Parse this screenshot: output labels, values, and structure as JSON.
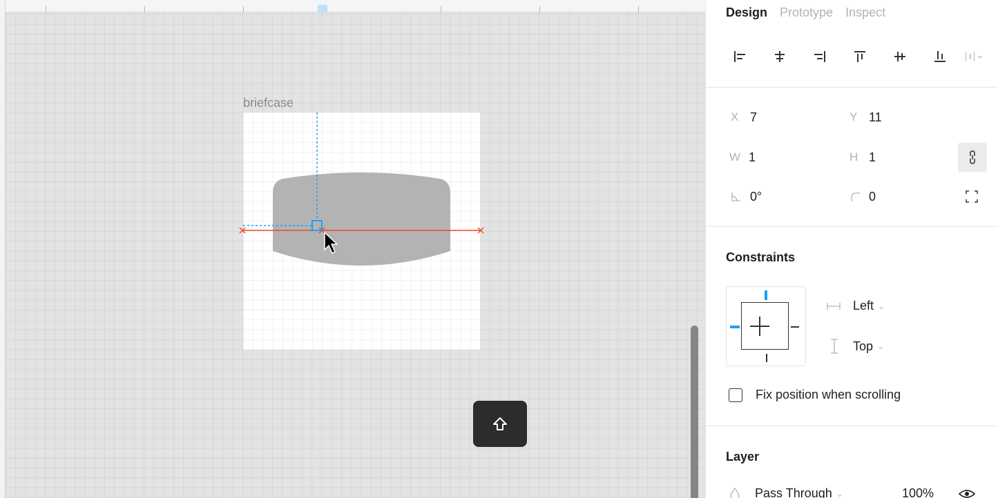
{
  "canvas": {
    "frame_label": "briefcase"
  },
  "tabs": [
    {
      "label": "Design",
      "active": true
    },
    {
      "label": "Prototype",
      "active": false
    },
    {
      "label": "Inspect",
      "active": false
    }
  ],
  "align_tools": [
    "align-left-icon",
    "align-horizontal-center-icon",
    "align-right-icon",
    "align-top-icon",
    "align-vertical-center-icon",
    "align-bottom-icon",
    "distribute-icon"
  ],
  "properties": {
    "x_label": "X",
    "x_value": "7",
    "y_label": "Y",
    "y_value": "11",
    "w_label": "W",
    "w_value": "1",
    "h_label": "H",
    "h_value": "1",
    "rotation_value": "0°",
    "radius_value": "0"
  },
  "constraints": {
    "title": "Constraints",
    "horizontal": "Left",
    "vertical": "Top",
    "fix_position_label": "Fix position when scrolling"
  },
  "layer": {
    "title": "Layer",
    "blend_mode": "Pass Through",
    "opacity": "100%"
  },
  "colors": {
    "accent": "#18a0fb",
    "measure_red": "#f24822",
    "shape_fill": "#b3b3b3",
    "shift_key_bg": "#2c2c2c"
  }
}
